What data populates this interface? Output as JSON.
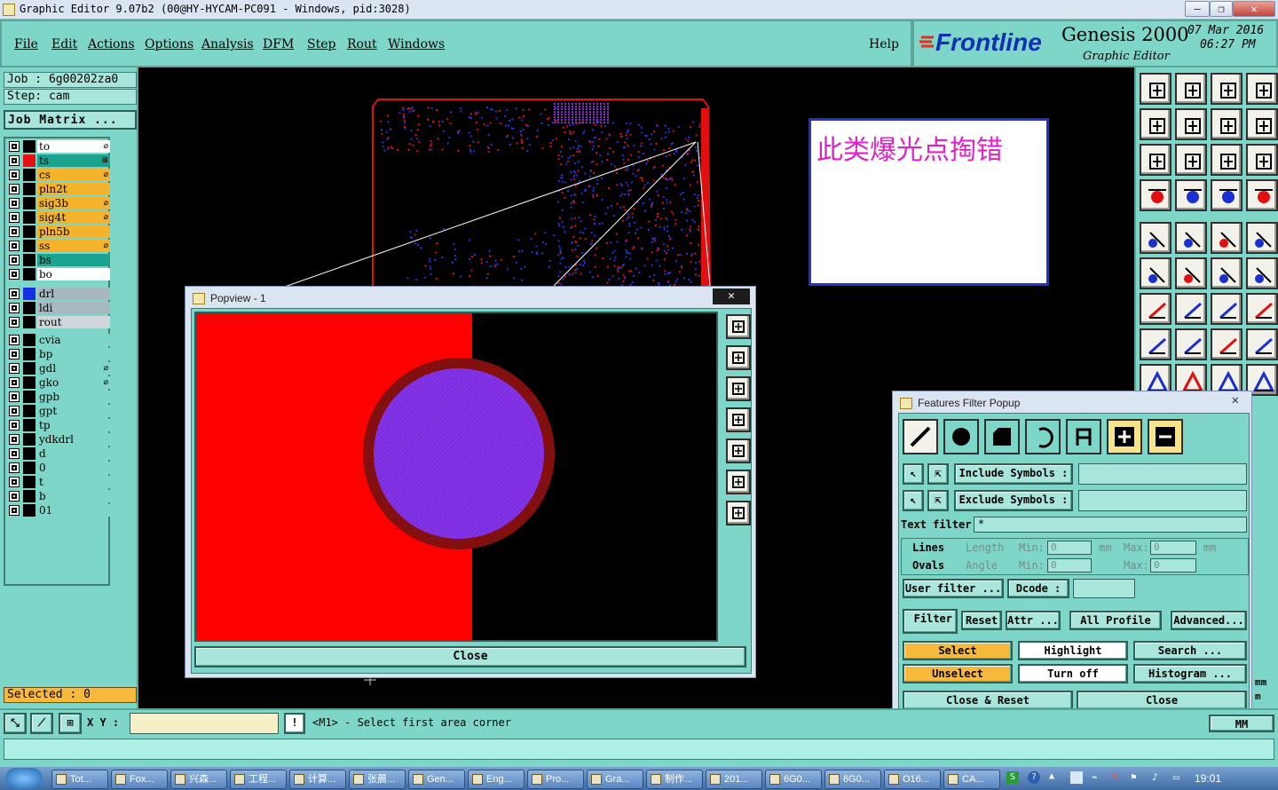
{
  "window": {
    "title": "Graphic Editor 9.07b2 (00@HY-HYCAM-PC091 - Windows, pid:3028)",
    "min_label": "—",
    "max_label": "❐",
    "close_label": "✕"
  },
  "menu": {
    "items": [
      "File",
      "Edit",
      "Actions",
      "Options",
      "Analysis",
      "DFM",
      "Step",
      "Rout",
      "Windows"
    ],
    "help": "Help"
  },
  "brand": {
    "logo": "Frontline",
    "product": "Genesis 2000",
    "subtitle": "Graphic Editor",
    "date": "07 Mar 2016",
    "time": "06:27 PM"
  },
  "job": {
    "job_line": "Job  :  6g00202za0",
    "step_line": "Step:  cam",
    "matrix_button": "Job Matrix ..."
  },
  "layers": {
    "group1": [
      {
        "name": "to",
        "color": "#ffffff",
        "swatch": "#000000",
        "mark": "⌀"
      },
      {
        "name": "ts",
        "color": "#1aa38f",
        "swatch": "#e81010",
        "mark": "⊞"
      },
      {
        "name": "cs",
        "color": "#f5b32c",
        "swatch": "#000000",
        "mark": "⌀"
      },
      {
        "name": "pln2t",
        "color": "#f5b32c",
        "swatch": "#000000",
        "mark": ""
      },
      {
        "name": "sig3b",
        "color": "#f5b32c",
        "swatch": "#000000",
        "mark": "⌀"
      },
      {
        "name": "sig4t",
        "color": "#f5b32c",
        "swatch": "#000000",
        "mark": "⌀"
      },
      {
        "name": "pln5b",
        "color": "#f5b32c",
        "swatch": "#000000",
        "mark": ""
      },
      {
        "name": "ss",
        "color": "#f5b32c",
        "swatch": "#000000",
        "mark": "⌀"
      },
      {
        "name": "bs",
        "color": "#1aa38f",
        "swatch": "#000000",
        "mark": ""
      },
      {
        "name": "bo",
        "color": "#ffffff",
        "swatch": "#000000",
        "mark": ""
      }
    ],
    "group2": [
      {
        "name": "drl",
        "color": "#a8b8c0",
        "swatch": "#1430e0",
        "mark": ""
      },
      {
        "name": "ldi",
        "color": "#a8b8c0",
        "swatch": "#000000",
        "mark": ""
      },
      {
        "name": "rout",
        "color": "#d0d6da",
        "swatch": "#000000",
        "mark": ""
      }
    ],
    "group3": [
      {
        "name": "cvia",
        "color": "#7dd6c7",
        "swatch": "#000000",
        "mark": ""
      },
      {
        "name": "bp",
        "color": "#7dd6c7",
        "swatch": "#000000",
        "mark": ""
      },
      {
        "name": "gdl",
        "color": "#7dd6c7",
        "swatch": "#000000",
        "mark": "⌀"
      },
      {
        "name": "gko",
        "color": "#7dd6c7",
        "swatch": "#000000",
        "mark": "⌀"
      },
      {
        "name": "gpb",
        "color": "#7dd6c7",
        "swatch": "#000000",
        "mark": ""
      },
      {
        "name": "gpt",
        "color": "#7dd6c7",
        "swatch": "#000000",
        "mark": ""
      },
      {
        "name": "tp",
        "color": "#7dd6c7",
        "swatch": "#000000",
        "mark": ""
      },
      {
        "name": "ydkdrl",
        "color": "#7dd6c7",
        "swatch": "#000000",
        "mark": ""
      },
      {
        "name": "d",
        "color": "#7dd6c7",
        "swatch": "#000000",
        "mark": ""
      },
      {
        "name": "0",
        "color": "#7dd6c7",
        "swatch": "#000000",
        "mark": ""
      },
      {
        "name": "t",
        "color": "#7dd6c7",
        "swatch": "#000000",
        "mark": ""
      },
      {
        "name": "b",
        "color": "#7dd6c7",
        "swatch": "#000000",
        "mark": ""
      },
      {
        "name": "01",
        "color": "#7dd6c7",
        "swatch": "#000000",
        "mark": ""
      }
    ]
  },
  "selected": "Selected : 0",
  "status": {
    "xy_label": "X Y :",
    "xy_value": "",
    "prompt": "<M1> - Select first area corner",
    "units": "MM",
    "mm_top": "mm",
    "mm_bottom": "m"
  },
  "annotation": {
    "text": "此类爆光点掏错"
  },
  "popview": {
    "title": "Popview - 1",
    "close_x": "✕",
    "close_button": "Close"
  },
  "features_filter": {
    "title": "Features Filter Popup",
    "close_x": "✕",
    "include_label": "Include Symbols :",
    "include_value": "",
    "exclude_label": "Exclude Symbols :",
    "exclude_value": "",
    "text_filter_label": "Text filter",
    "text_filter_value": "*",
    "lines_label": "Lines",
    "ovals_label": "Ovals",
    "length_label": "Length",
    "angle_label": "Angle",
    "min_label": "Min:",
    "max_label": "Max:",
    "min_value": "0",
    "max_value": "0",
    "angle_min_value": "0",
    "angle_max_value": "0",
    "unit_mm": "mm",
    "user_filter": "User filter ...",
    "dcode": "Dcode :",
    "dcode_value": "",
    "filter": "Filter",
    "reset": "Reset",
    "attr": "Attr ...",
    "all_profile": "All Profile",
    "advanced": "Advanced...",
    "select": "Select",
    "highlight": "Highlight",
    "search": "Search ...",
    "unselect": "Unselect",
    "turn_off": "Turn off",
    "histogram": "Histogram ...",
    "close_reset": "Close & Reset",
    "close": "Close"
  },
  "taskbar": {
    "items": [
      "Tot...",
      "Fox...",
      "兴森...",
      "工程...",
      "计算...",
      "张晨...",
      "Gen...",
      "Eng...",
      "Pro...",
      "Gra...",
      "制作...",
      "201...",
      "6G0...",
      "6G0...",
      "O16...",
      "CA..."
    ],
    "clock": "19:01"
  }
}
